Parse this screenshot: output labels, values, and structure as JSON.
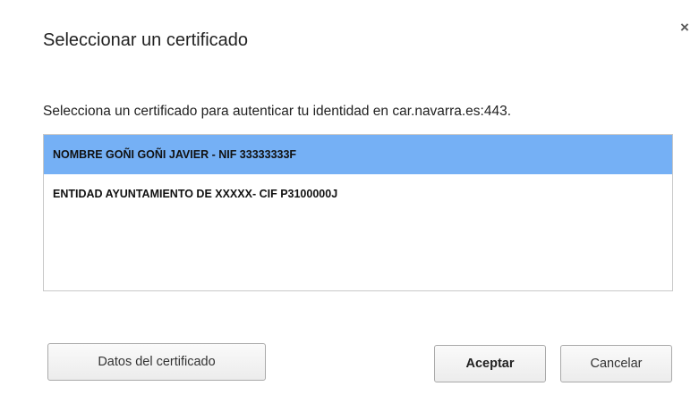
{
  "dialog": {
    "title": "Seleccionar un certificado",
    "close_glyph": "×",
    "prompt": "Selecciona un certificado para autenticar tu identidad en car.navarra.es:443."
  },
  "certificates": [
    {
      "label": "NOMBRE GOÑI GOÑI JAVIER - NIF 33333333F",
      "selected": true
    },
    {
      "label": "ENTIDAD AYUNTAMIENTO DE XXXXX- CIF P3100000J",
      "selected": false
    }
  ],
  "buttons": {
    "details_label": "Datos del certificado",
    "accept_label": "Aceptar",
    "cancel_label": "Cancelar"
  },
  "colors": {
    "selection": "#75b0f5",
    "border": "#c8c8c8"
  },
  "icons": {
    "close": "close-icon"
  }
}
